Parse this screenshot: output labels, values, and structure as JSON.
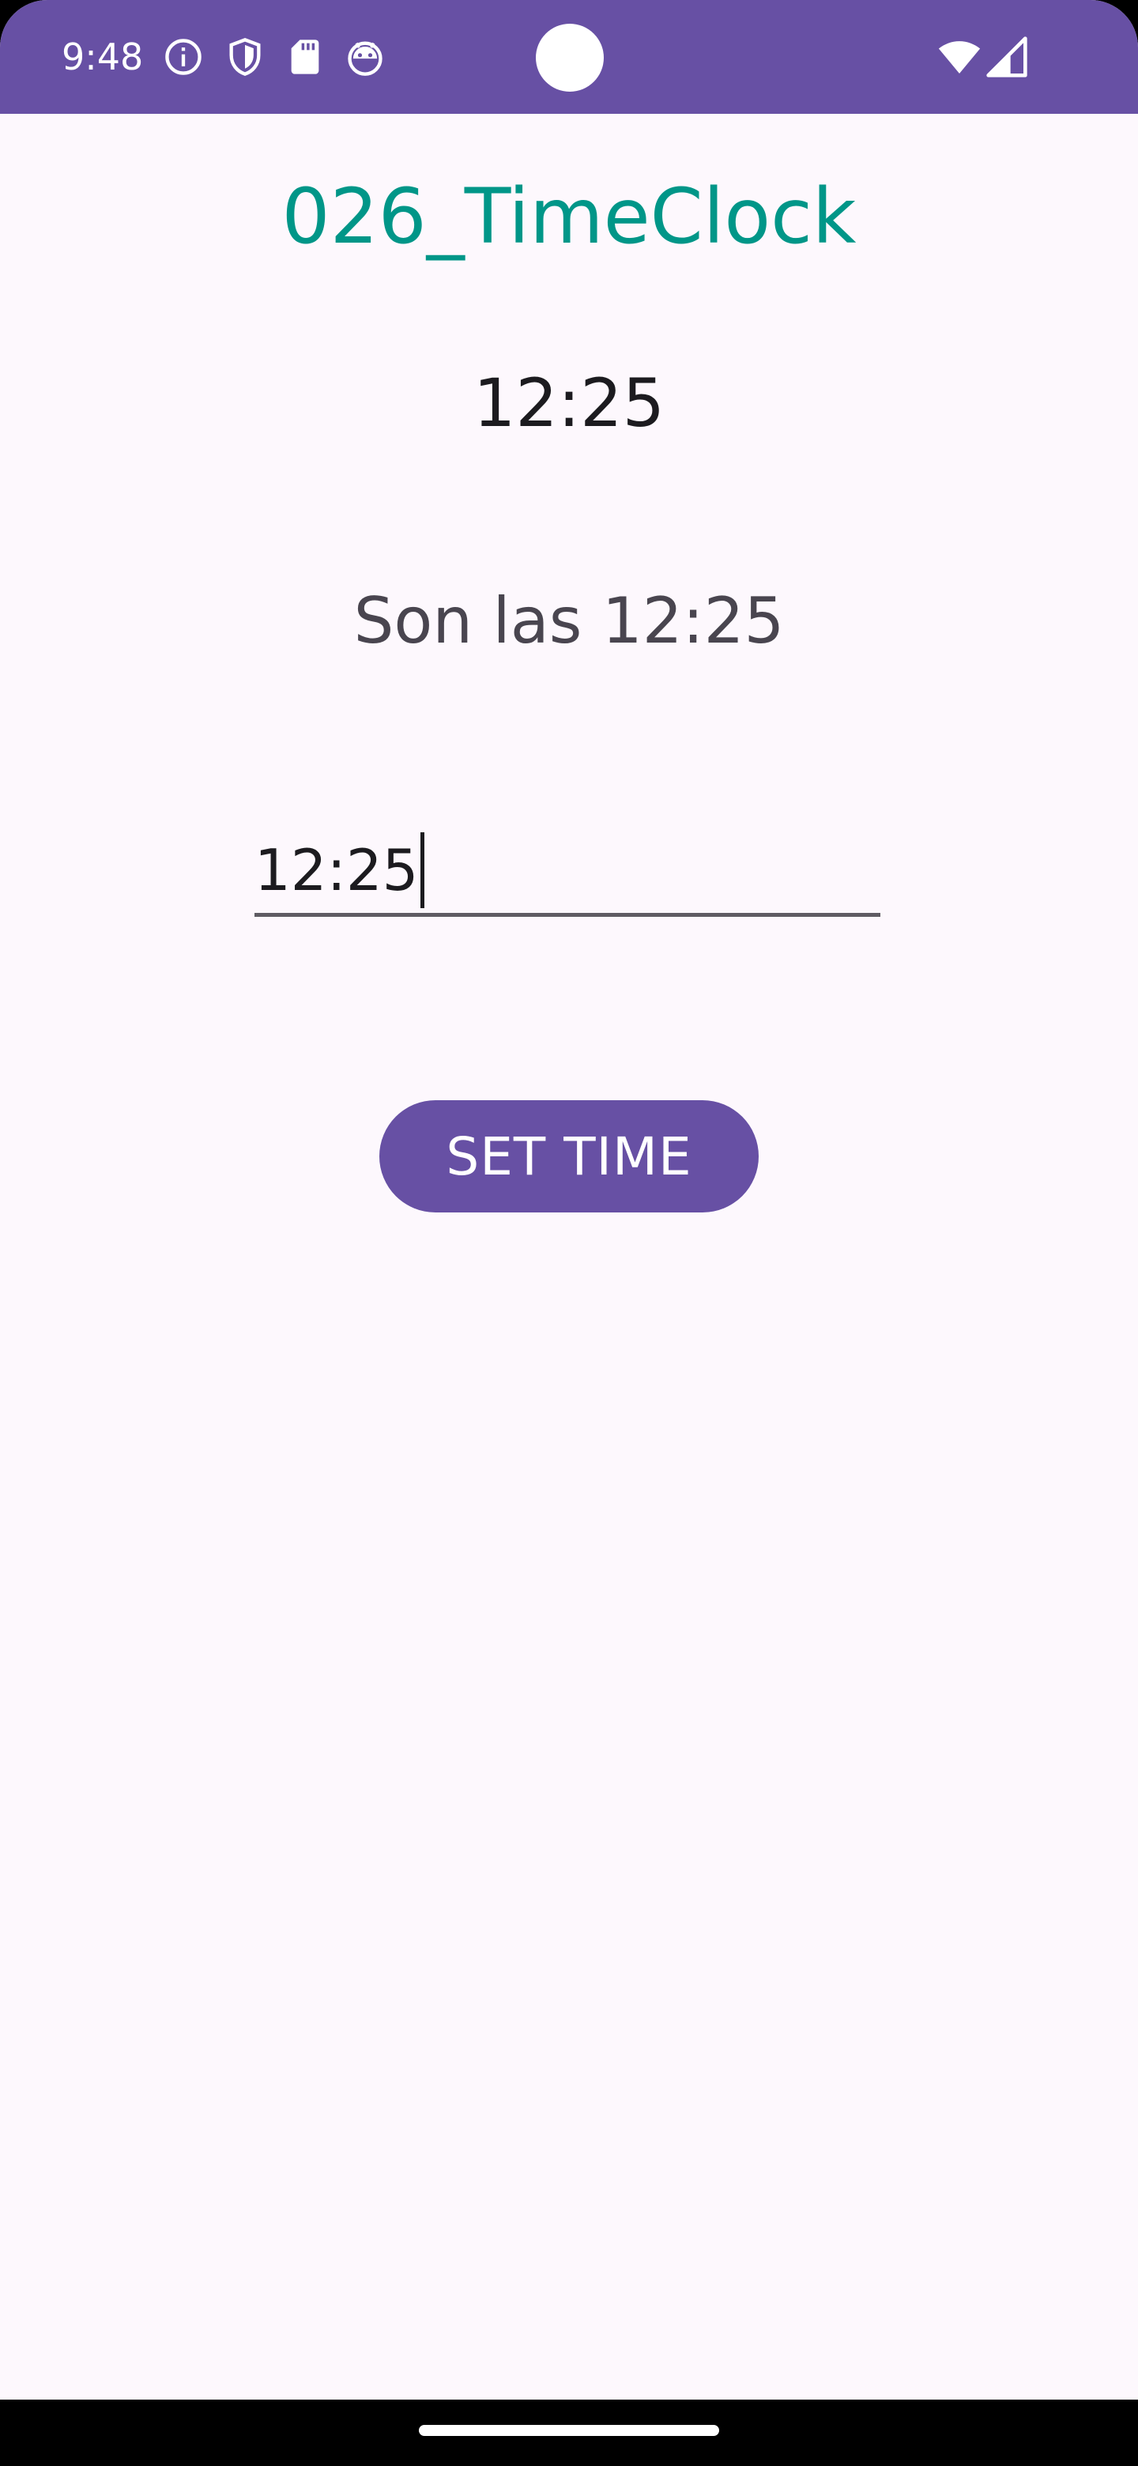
{
  "status_bar": {
    "time": "9:48",
    "icons": [
      "info-icon",
      "shield-icon",
      "sd-card-icon",
      "android-head-icon",
      "wifi-icon",
      "cell-signal-icon"
    ],
    "background": "#6750A4"
  },
  "app": {
    "title": "026_TimeClock",
    "title_color": "#009688"
  },
  "clock": {
    "time": "12:25"
  },
  "message": {
    "text": "Son las 12:25"
  },
  "time_input": {
    "value": "12:25"
  },
  "button": {
    "label": "SET TIME",
    "color": "#6750A4"
  }
}
